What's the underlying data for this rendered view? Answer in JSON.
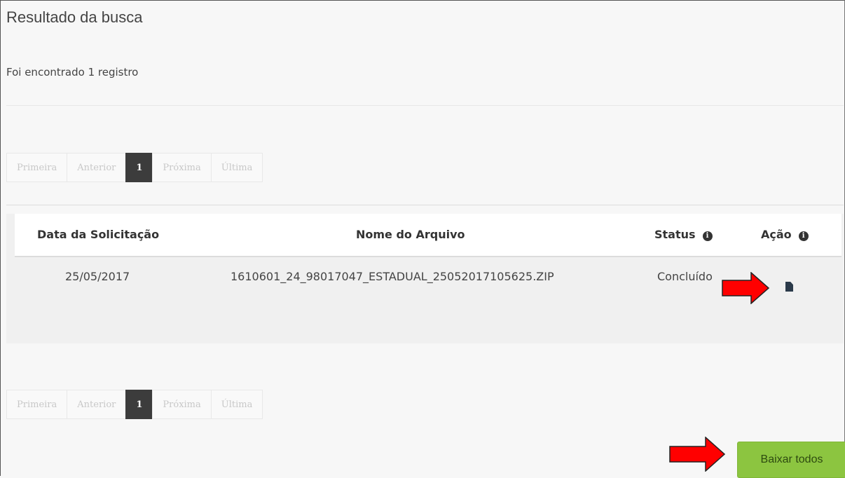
{
  "page": {
    "title": "Resultado da busca",
    "count_text": "Foi encontrado 1 registro"
  },
  "pagination": {
    "first": "Primeira",
    "prev": "Anterior",
    "current": "1",
    "next": "Próxima",
    "last": "Última"
  },
  "table": {
    "headers": {
      "date": "Data da Solicitação",
      "name": "Nome do Arquivo",
      "status": "Status",
      "action": "Ação"
    },
    "rows": [
      {
        "date": "25/05/2017",
        "name": "1610601_24_98017047_ESTADUAL_25052017105625.ZIP",
        "status": "Concluído"
      }
    ]
  },
  "icons": {
    "info": "info-icon",
    "download_file": "document-icon",
    "annotation": "red-arrow"
  },
  "buttons": {
    "download_all": "Baixar todos"
  },
  "colors": {
    "accent_green": "#8cc540",
    "arrow_red": "#ff0000",
    "pager_active": "#3c3c3c"
  }
}
